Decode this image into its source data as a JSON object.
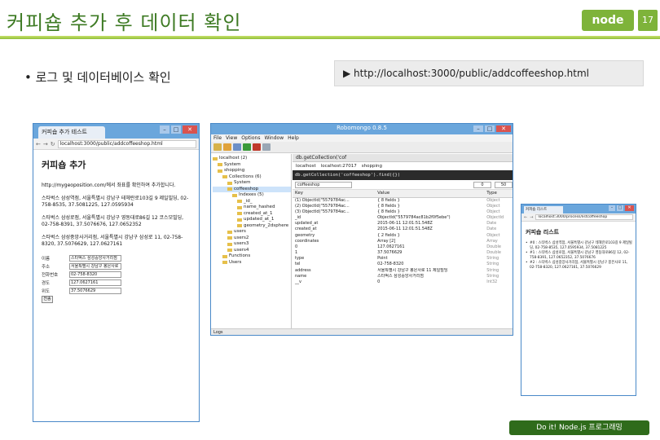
{
  "slide": {
    "title": "커피숍 추가 후 데이터 확인",
    "brand": "node",
    "page_number": "17",
    "bullet": "• 로그 및 데이터베이스 확인",
    "url": "▶ http://localhost:3000/public/addcoffeeshop.html",
    "footer": "Do it! Node.js 프로그래밍"
  },
  "browser": {
    "tab_title": "커피숍 추가 테스트",
    "address": "localhost:3000/public/addcoffeeshop.html",
    "heading": "커피숍 추가",
    "lines": [
      "http://mygeoposition.com/에서 좌표를 확인하여 추가합니다.",
      "스타벅스 삼성역점, 서울특별시 강남구 테헤란로103길 9 제일빌딩, 02-758-8535, 37.5081225, 127.0595934",
      "스타벅스 삼성로점, 서울특별시 강남구 영동대로86길 12 코스모빌딩, 02-758-8391, 37.5076676, 127.0652352",
      "스타벅스 삼성중앙사거리점, 서울특별시 강남구 삼성로 11, 02-758-8320, 37.5076629, 127.0627161"
    ],
    "form": [
      {
        "label": "이름",
        "value": "스타벅스 삼성중앙사거리점"
      },
      {
        "label": "주소",
        "value": "서울특별시 강남구 봉은사로"
      },
      {
        "label": "전화번호",
        "value": "02-758-8320"
      },
      {
        "label": "경도",
        "value": "127.0627161"
      },
      {
        "label": "위도",
        "value": "37.5076629"
      }
    ],
    "save_label": "전송"
  },
  "robomongo": {
    "window_title": "Robomongo 0.8.5",
    "menu": [
      "File",
      "View",
      "Options",
      "Window",
      "Help"
    ],
    "tree": [
      {
        "label": "localhost (2)",
        "indent": 0,
        "selected": false
      },
      {
        "label": "System",
        "indent": 1,
        "selected": false
      },
      {
        "label": "shopping",
        "indent": 1,
        "selected": false
      },
      {
        "label": "Collections (6)",
        "indent": 2,
        "selected": false
      },
      {
        "label": "System",
        "indent": 3,
        "selected": false
      },
      {
        "label": "coffeeshop",
        "indent": 3,
        "selected": true
      },
      {
        "label": "Indexes (5)",
        "indent": 4,
        "selected": false
      },
      {
        "label": "_id_",
        "indent": 5,
        "selected": false
      },
      {
        "label": "name_hashed",
        "indent": 5,
        "selected": false
      },
      {
        "label": "created_at_1",
        "indent": 5,
        "selected": false
      },
      {
        "label": "updated_at_1",
        "indent": 5,
        "selected": false
      },
      {
        "label": "geometry_2dsphere",
        "indent": 5,
        "selected": false
      },
      {
        "label": "users",
        "indent": 3,
        "selected": false
      },
      {
        "label": "users2",
        "indent": 3,
        "selected": false
      },
      {
        "label": "users3",
        "indent": 3,
        "selected": false
      },
      {
        "label": "users4",
        "indent": 3,
        "selected": false
      },
      {
        "label": "Functions",
        "indent": 2,
        "selected": false
      },
      {
        "label": "Users",
        "indent": 2,
        "selected": false
      }
    ],
    "query_tab": "db.getCollection('cof",
    "conn_host": "localhost",
    "conn_port": "localhost:27017",
    "conn_db": "shopping",
    "command": "db.getCollection('coffeeshop').find({})",
    "result_name": "coffeeshop",
    "page_from": "0",
    "page_size": "50",
    "columns": [
      "Key",
      "Value",
      "Type"
    ],
    "rows": [
      {
        "key": "(1) ObjectId(\"5579784ac...",
        "value": "{ 8 fields }",
        "type": "Object"
      },
      {
        "key": "(2) ObjectId(\"5579784ac...",
        "value": "{ 8 fields }",
        "type": "Object"
      },
      {
        "key": "(3) ObjectId(\"5579784ac...",
        "value": "{ 8 fields }",
        "type": "Object"
      },
      {
        "key": "_id",
        "value": "ObjectId(\"5579784ac81b2f0f5ebe\")",
        "type": "ObjectId"
      },
      {
        "key": "updated_at",
        "value": "2015-06-11 12:01:51.548Z",
        "type": "Date"
      },
      {
        "key": "created_at",
        "value": "2015-06-11 12:01:51.548Z",
        "type": "Date"
      },
      {
        "key": "geometry",
        "value": "{ 2 fields }",
        "type": "Object"
      },
      {
        "key": "coordinates",
        "value": "Array [2]",
        "type": "Array"
      },
      {
        "key": "0",
        "value": "127.0627161",
        "type": "Double"
      },
      {
        "key": "1",
        "value": "37.5076629",
        "type": "Double"
      },
      {
        "key": "type",
        "value": "Point",
        "type": "String"
      },
      {
        "key": "tel",
        "value": "02-758-8320",
        "type": "String"
      },
      {
        "key": "address",
        "value": "서울특별시 강남구 봉은사로 11 제일빌딩",
        "type": "String"
      },
      {
        "key": "name",
        "value": "스타벅스 삼성중앙사거리점",
        "type": "String"
      },
      {
        "key": "__v",
        "value": "0",
        "type": "Int32"
      }
    ],
    "log_label": "Logs"
  },
  "browser2": {
    "tab_title": "커피숍 리스트",
    "address": "localhost:3000/process/listcoffeeshop",
    "heading": "커피숍 리스트",
    "items": [
      "#0 : 스타벅스 삼성역점, 서울특별시 강남구 테헤란로103길 9 제일빌딩, 02-758-8535, 127.0595934, 37.5081225",
      "#1 : 스타벅스 삼성로점, 서울특별시 강남구 영동대로86길 12, 02-758-8391, 127.0652352, 37.5076676",
      "#2 : 스타벅스 삼성중앙사거리점, 서울특별시 강남구 봉은사로 11, 02-758-8320, 127.0627161, 37.5076629"
    ]
  },
  "colors": {
    "accent_green": "#7eb33a",
    "title_green": "#3d7a23",
    "window_blue": "#6aa6dc",
    "footer_green": "#2f6b1b"
  }
}
